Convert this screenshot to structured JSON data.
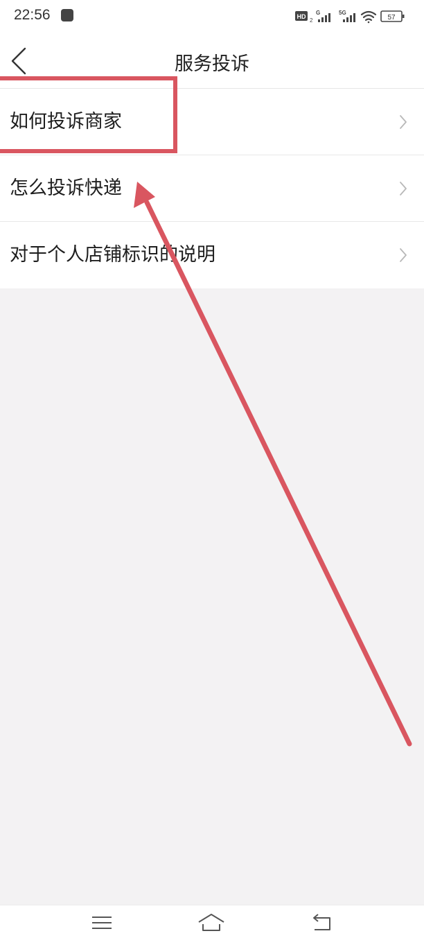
{
  "status_bar": {
    "time": "22:56",
    "battery": "57",
    "network_badges": [
      "HD2",
      "G",
      "5G"
    ]
  },
  "header": {
    "title": "服务投诉"
  },
  "list": {
    "items": [
      {
        "label": "如何投诉商家"
      },
      {
        "label": "怎么投诉快递"
      },
      {
        "label": "对于个人店铺标识的说明"
      }
    ]
  },
  "annotation": {
    "color": "#d95660",
    "highlighted_item": "如何投诉商家"
  },
  "nav_bar": {
    "icons": [
      "menu-icon",
      "home-icon",
      "back-icon"
    ]
  }
}
